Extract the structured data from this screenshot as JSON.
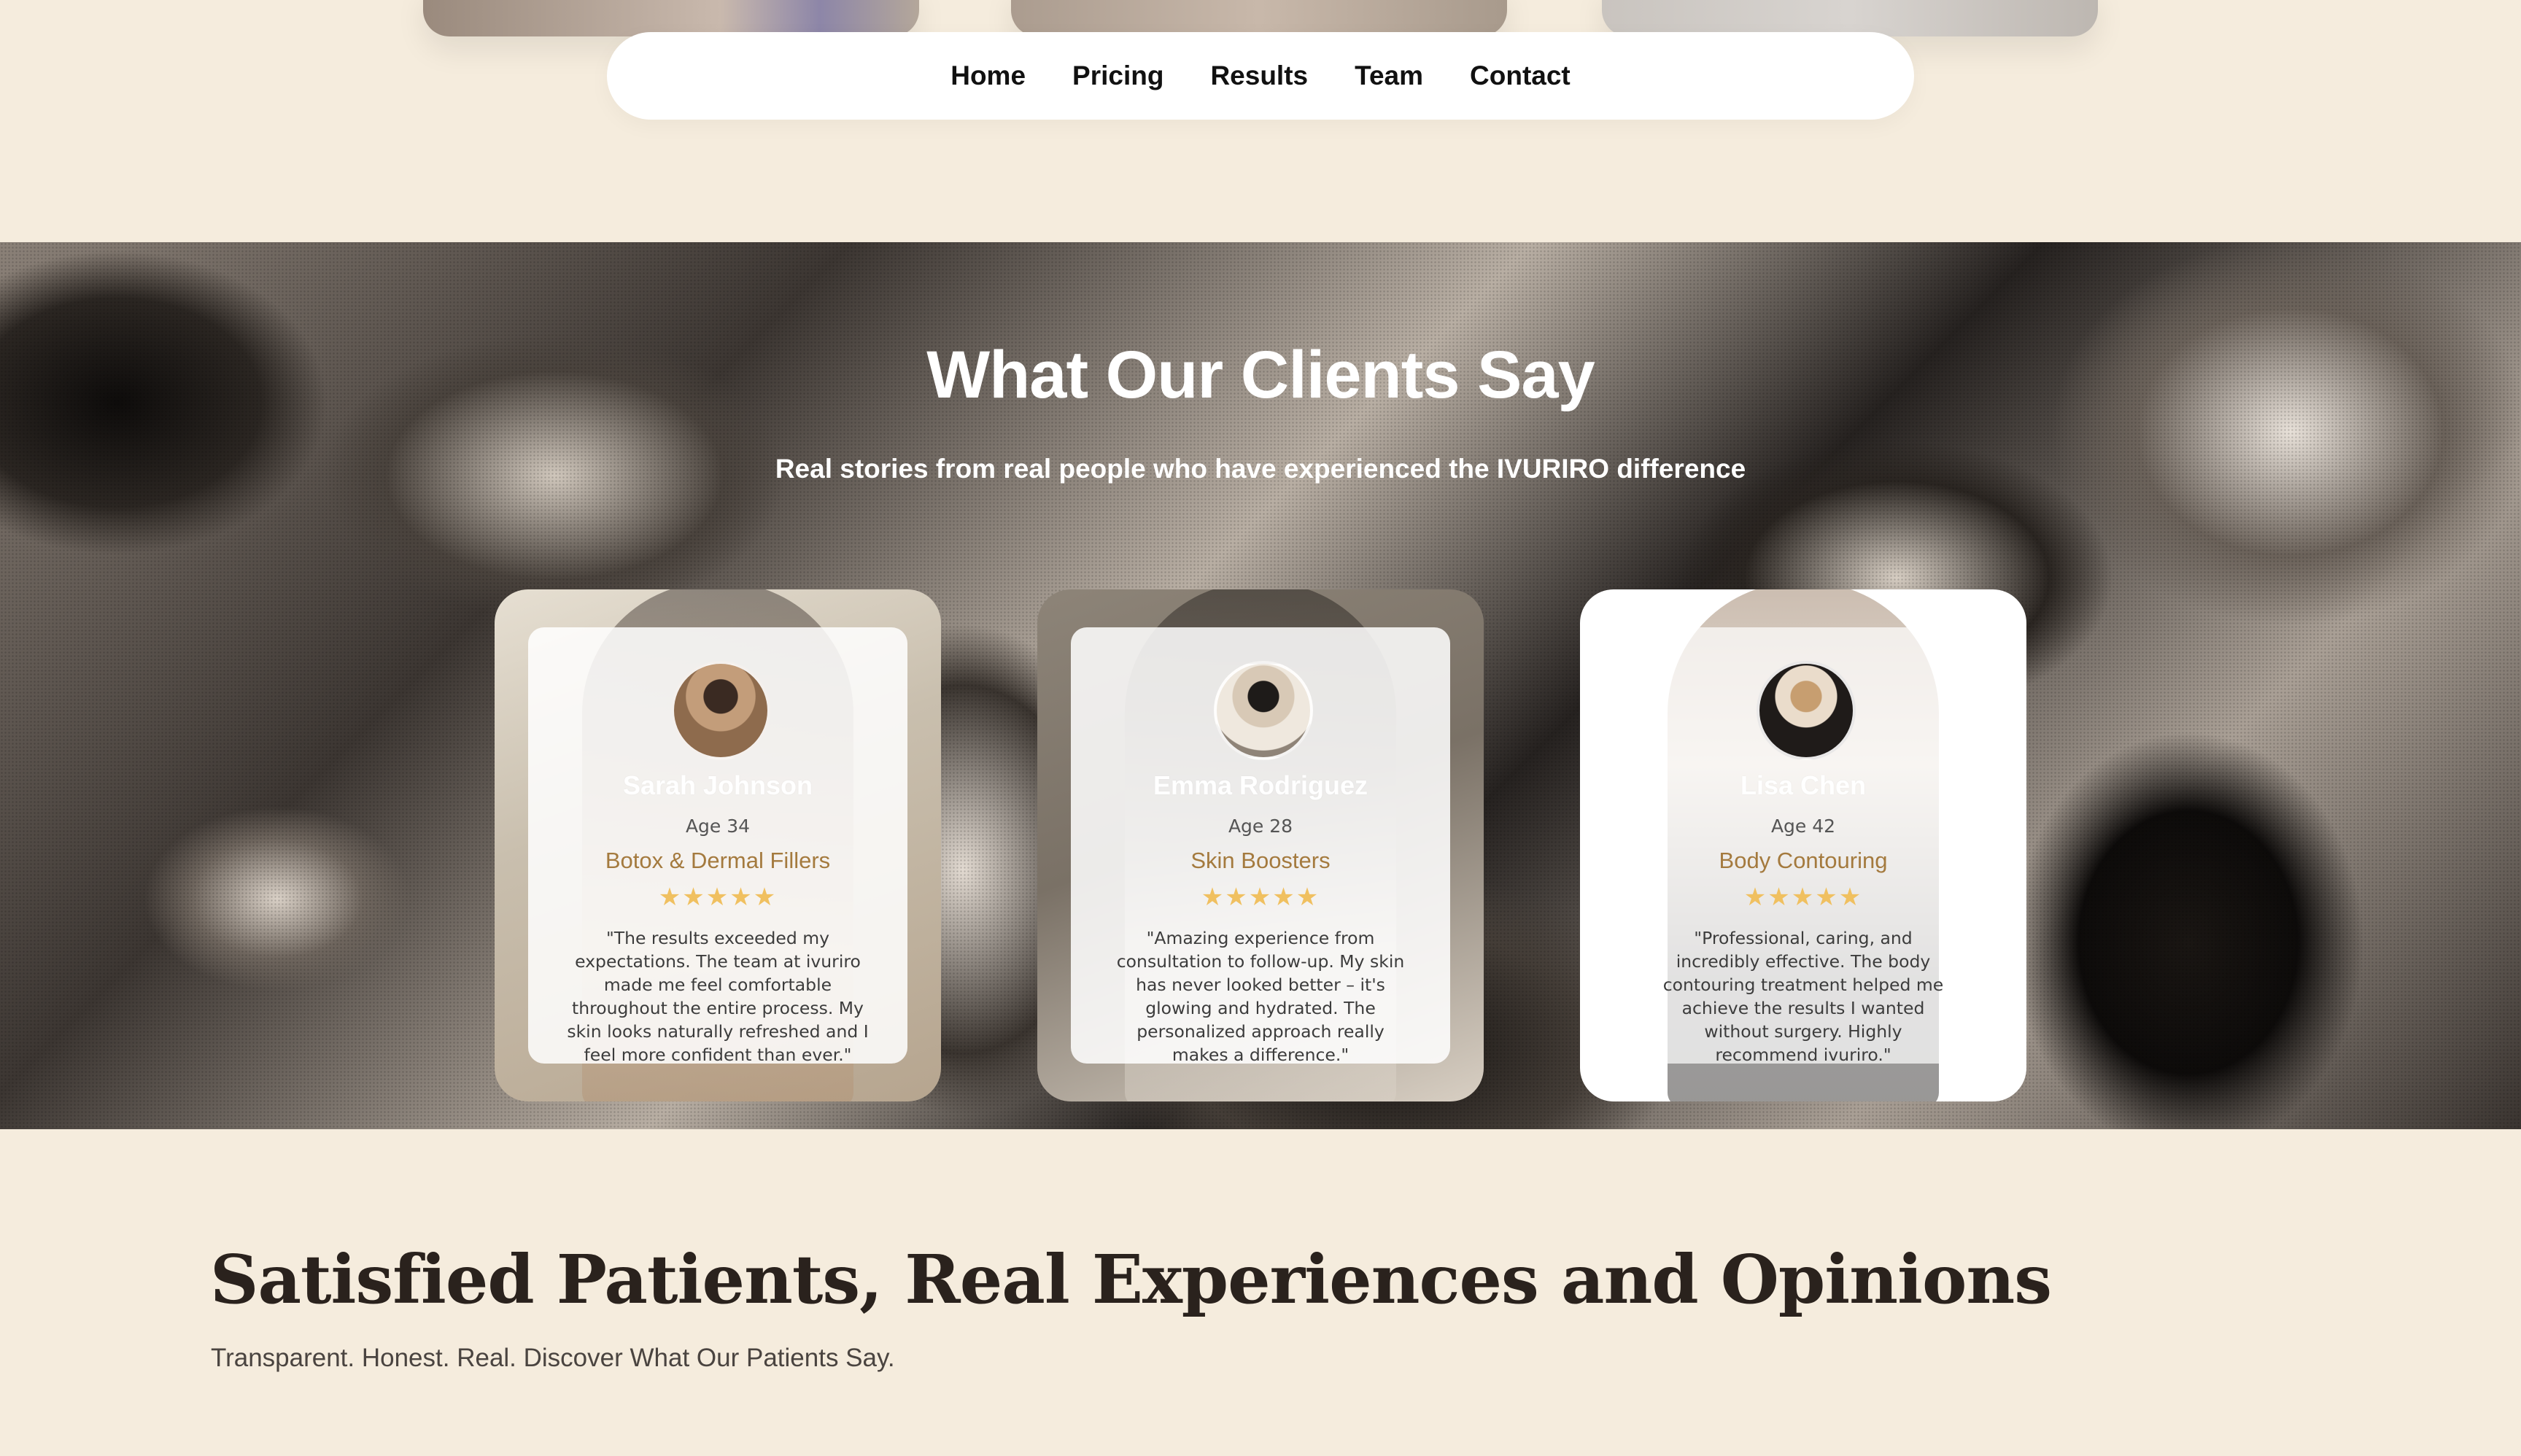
{
  "nav": {
    "items": [
      "Home",
      "Pricing",
      "Results",
      "Team",
      "Contact"
    ]
  },
  "testimonials": {
    "title": "What Our Clients Say",
    "subtitle": "Real stories from real people who have experienced the IVURIRO difference",
    "cards": [
      {
        "name": "Sarah Johnson",
        "age": "Age 34",
        "treatment": "Botox & Dermal Fillers",
        "stars": "★★★★★",
        "quote": "\"The results exceeded my expectations. The team at ivuriro made me feel comfortable throughout the entire process. My skin looks naturally refreshed and I feel more confident than ever.\""
      },
      {
        "name": "Emma Rodriguez",
        "age": "Age 28",
        "treatment": "Skin Boosters",
        "stars": "★★★★★",
        "quote": "\"Amazing experience from consultation to follow-up. My skin has never looked better – it's glowing and hydrated. The personalized approach really makes a difference.\""
      },
      {
        "name": "Lisa Chen",
        "age": "Age 42",
        "treatment": "Body Contouring",
        "stars": "★★★★★",
        "quote": "\"Professional, caring, and incredibly effective. The body contouring treatment helped me achieve the results I wanted without surgery. Highly recommend ivuriro.\""
      }
    ]
  },
  "section": {
    "title": "Satisfied Patients, Real Experiences and Opinions",
    "subtitle": "Transparent. Honest. Real. Discover What Our Patients Say."
  },
  "colors": {
    "page_background": "#f5ecdd",
    "accent_treatment": "#a47a3e",
    "star": "#f0c060"
  }
}
